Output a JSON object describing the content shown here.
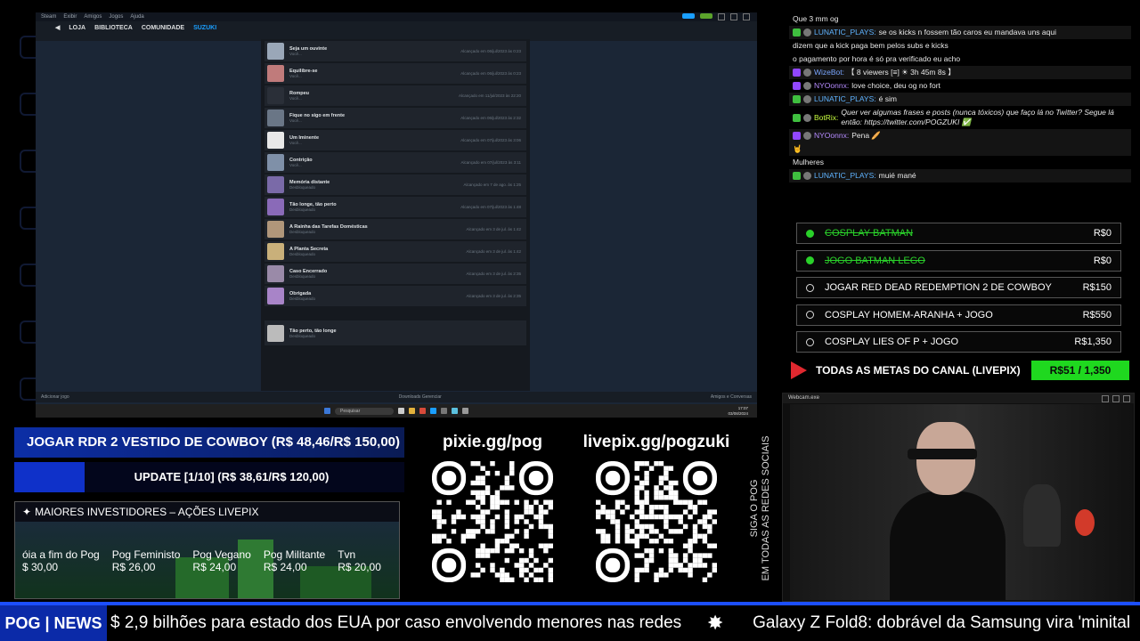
{
  "screen": {
    "titlebar_menu": [
      "Steam",
      "Exibir",
      "Amigos",
      "Jogos",
      "Ajuda"
    ],
    "nav": {
      "store": "LOJA",
      "library": "BIBLIOTECA",
      "community": "COMUNIDADE",
      "user": "SUZUKI"
    },
    "achievements": [
      {
        "name": "Seja um ouvinte",
        "desc": "Você...",
        "date": "Alcançado em 06/jul/2023 às 0:23"
      },
      {
        "name": "Equilibre-se",
        "desc": "Você...",
        "date": "Alcançado em 06/jul/2023 às 0:23"
      },
      {
        "name": "Rompeu",
        "desc": "Você...",
        "date": "Alcançado em 11/jul/2023 às 22:20"
      },
      {
        "name": "Fique no sigo em frente",
        "desc": "Você...",
        "date": "Alcançado em 06/jul/2023 às 2:32"
      },
      {
        "name": "Um Iminente",
        "desc": "Você...",
        "date": "Alcançado em 07/jul/2023 às 3:06"
      },
      {
        "name": "Contrição",
        "desc": "Você...",
        "date": "Alcançado em 07/jul/2023 às 3:11"
      },
      {
        "name": "Memória distante",
        "desc": "Desbloqueado",
        "date": "Alcançado em 7 de ago. às 1:25"
      },
      {
        "name": "Tão longe, tão perto",
        "desc": "Desbloqueado",
        "date": "Alcançado em 07/jul/2023 às 1:48"
      },
      {
        "name": "A Rainha das Tarefas Domésticas",
        "desc": "Desbloqueado",
        "date": "Alcançado em 3 de jul. às 1:42"
      },
      {
        "name": "A Planta Secreta",
        "desc": "Desbloqueado",
        "date": "Alcançado em 3 de jul. às 1:42"
      },
      {
        "name": "Caso Encerrado",
        "desc": "Desbloqueado",
        "date": "Alcançado em 3 de jul. às 2:35"
      },
      {
        "name": "Obrigada",
        "desc": "Desbloqueado",
        "date": "Alcançado em 3 de jul. às 2:35"
      }
    ],
    "special": {
      "name": "Tão perto, tão longe",
      "desc": "Desbloqueado"
    },
    "status_left": "Adicionar jogo",
    "status_mid": "Downloads Gerenciar",
    "status_right": "Amigos e Conversas",
    "taskbar_search": "Pesquisar",
    "clock_time": "17:07",
    "clock_date": "03/08/2024"
  },
  "chat": [
    {
      "badge": "none",
      "user": "",
      "text": "Que 3 mm og",
      "alt": false
    },
    {
      "badge": "green",
      "user": "LUNATIC_PLAYS:",
      "ucls": "lunatic",
      "text": "se os kicks n fossem tão caros eu mandava uns aqui",
      "alt": true
    },
    {
      "badge": "none",
      "user": "",
      "text": "dizem que a kick paga bem pelos subs e kicks",
      "alt": false
    },
    {
      "badge": "none",
      "user": "",
      "text": "o pagamento por hora é só pra verificado eu acho",
      "alt": false
    },
    {
      "badge": "purple",
      "user": "WizeBot:",
      "ucls": "wizebot",
      "text": "【 8 viewers [≡] ☀ 3h 45m 8s 】",
      "alt": true
    },
    {
      "badge": "purple",
      "user": "NYOonnx:",
      "ucls": "nyo",
      "text": "love choice, deu og no fort",
      "alt": false
    },
    {
      "badge": "green",
      "user": "LUNATIC_PLAYS:",
      "ucls": "lunatic",
      "text": "é sim",
      "alt": true
    },
    {
      "badge": "green",
      "user": "BotRix:",
      "ucls": "botrix",
      "text": "Quer ver algumas frases e posts (nunca tóxicos) que faço lá no Twitter? Segue lá então: https://twitter.com/POGZUKI ✅",
      "alt": false,
      "italic": true
    },
    {
      "badge": "purple",
      "user": "NYOonnx:",
      "ucls": "nyo",
      "text": "Pena 🥖",
      "alt": true
    },
    {
      "badge": "none",
      "user": "",
      "text": "🤘",
      "alt": true
    },
    {
      "badge": "none",
      "user": "",
      "text": "Mulheres",
      "alt": false
    },
    {
      "badge": "green",
      "user": "LUNATIC_PLAYS:",
      "ucls": "lunatic",
      "text": "muié mané",
      "alt": true
    }
  ],
  "goals": [
    {
      "label": "COSPLAY BATMAN",
      "price": "R$0",
      "done": true
    },
    {
      "label": "JOGO BATMAN LEGO",
      "price": "R$0",
      "done": true
    },
    {
      "label": "JOGAR RED DEAD REDEMPTION 2 DE COWBOY",
      "price": "R$150",
      "done": false
    },
    {
      "label": "COSPLAY HOMEM-ARANHA + JOGO",
      "price": "R$550",
      "done": false
    },
    {
      "label": "COSPLAY LIES OF P + JOGO",
      "price": "R$1,350",
      "done": false
    }
  ],
  "goal_bar": {
    "title": "TODAS AS METAS DO CANAL (LIVEPIX)",
    "amount": "R$51 / 1,350"
  },
  "webcam": {
    "title": "Webcam.exe"
  },
  "info1": "JOGAR RDR 2 VESTIDO DE COWBOY (R$ 48,46/R$ 150,00)",
  "info2": "UPDATE [1/10] (R$ 38,61/R$ 120,00)",
  "investors": {
    "title": "MAIORES INVESTIDORES – AÇÕES LIVEPIX",
    "items": [
      {
        "name": "óia a fim do Pog",
        "value": "$ 30,00"
      },
      {
        "name": "Pog Feministo",
        "value": "R$ 26,00"
      },
      {
        "name": "Pog Vegano",
        "value": "R$ 24,00"
      },
      {
        "name": "Pog Militante",
        "value": "R$ 24,00"
      },
      {
        "name": "Tvn",
        "value": "R$ 20,00"
      }
    ]
  },
  "qr1": "pixie.gg/pog",
  "qr2": "livepix.gg/pogzuki",
  "vertical": {
    "line1": "SIGA O POG",
    "line2": "EM TODAS AS REDES SOCIAIS"
  },
  "ticker": {
    "brand": "POG | NEWS",
    "news1": "$ 2,9 bilhões para estado dos EUA por caso envolvendo menores nas redes",
    "news2": "Galaxy Z Fold8: dobrável da Samsung vira 'minital"
  },
  "colors": {
    "accent": "#1c4fff",
    "goal_done": "#2ad12a",
    "goal_bar": "#1fd81f",
    "play": "#e0282f"
  }
}
